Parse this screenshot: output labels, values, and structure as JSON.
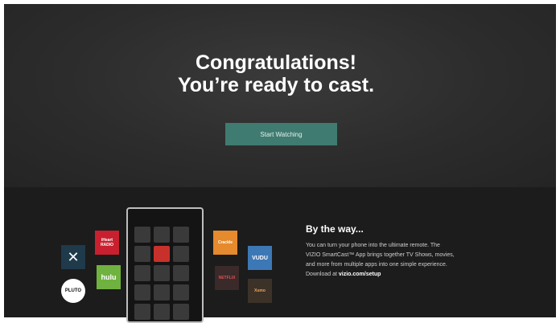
{
  "hero": {
    "title_line1": "Congratulations!",
    "title_line2": "You’re ready to cast.",
    "start_button_label": "Start Watching"
  },
  "apps": {
    "x_tile": "✕",
    "iheart_tile": "iHeart RADIO",
    "hulu_tile": "hulu",
    "pluto_tile": "PLUTO",
    "orange_tile": "Crackle",
    "vudu_tile": "VUDU",
    "dark_tile": "NETFLIX",
    "last_tile": "Xumo"
  },
  "info": {
    "title": "By the way...",
    "body_line1": "You can turn your phone into the ultimate remote. The",
    "body_line2": "VIZIO SmartCast™ App brings together TV Shows, movies,",
    "body_line3": "and more from multiple apps into one simple experience.",
    "body_line4_prefix": "Download at ",
    "body_link": "vizio.com/setup"
  },
  "colors": {
    "accent_button": "#3f7b70",
    "background": "#262626"
  }
}
